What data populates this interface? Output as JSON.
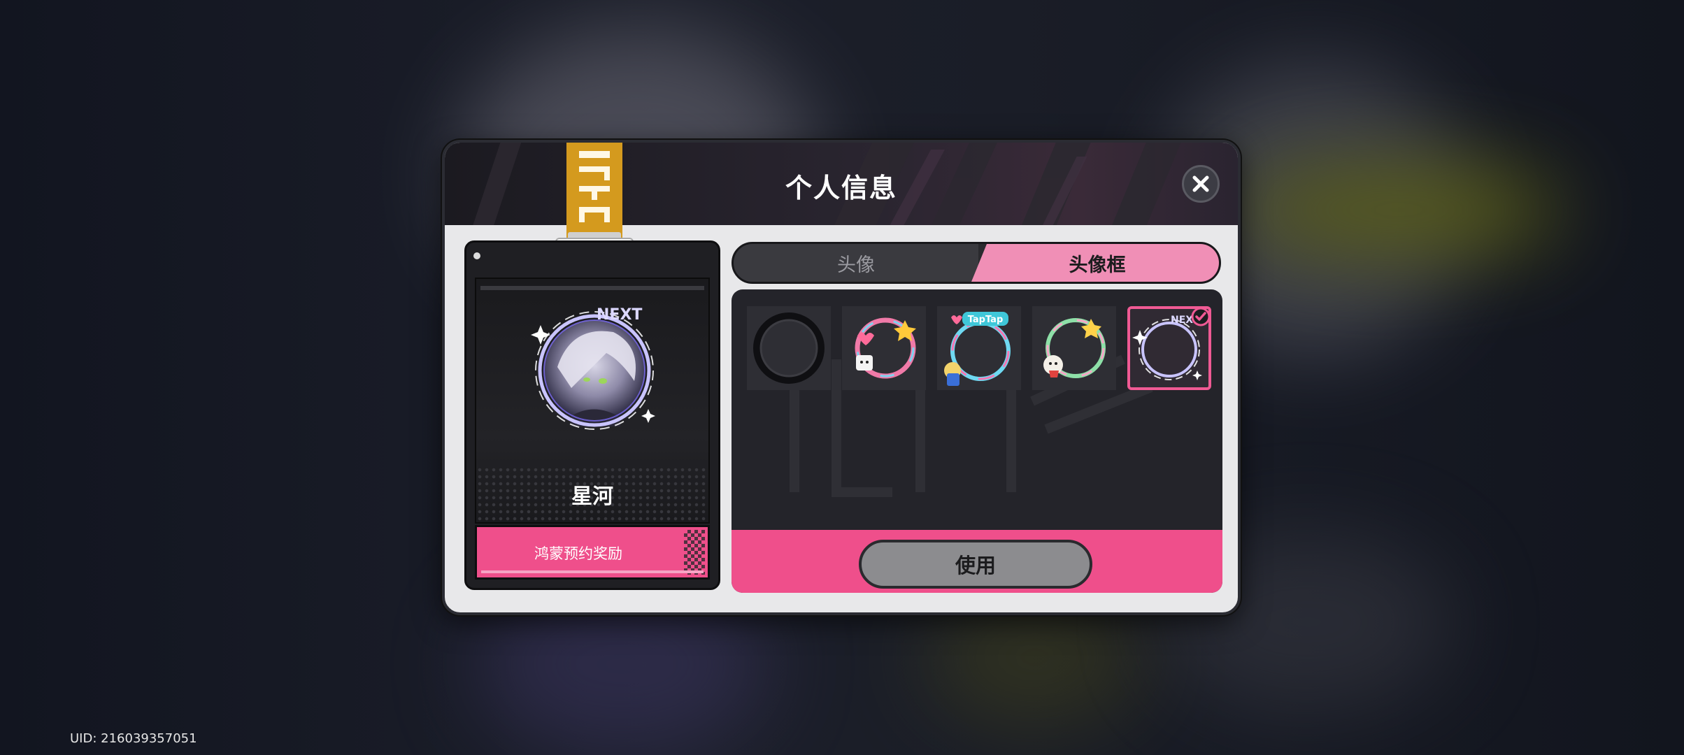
{
  "window": {
    "title": "个人信息"
  },
  "header": {
    "close_icon": "close-icon",
    "lanyard_text": "NEXT"
  },
  "profile_card": {
    "name": "星河",
    "frame_badge_text": "NEXT",
    "reward_label": "鸿蒙预约奖励"
  },
  "tabs": [
    {
      "label": "头像",
      "active": false
    },
    {
      "label": "头像框",
      "active": true
    }
  ],
  "frames": [
    {
      "name": "default-frame",
      "selected": false
    },
    {
      "name": "hearts-frame",
      "selected": false
    },
    {
      "name": "taptap-frame",
      "selected": false,
      "text": "TapTap"
    },
    {
      "name": "floral-frame",
      "selected": false
    },
    {
      "name": "next-frame",
      "selected": true,
      "text": "NEXT"
    }
  ],
  "actions": {
    "use_label": "使用"
  },
  "footer": {
    "uid": "UID: 216039357051"
  },
  "colors": {
    "accent_pink": "#ef4f8b",
    "tab_pink": "#f08fb6",
    "lanyard": "#d49a1e"
  }
}
